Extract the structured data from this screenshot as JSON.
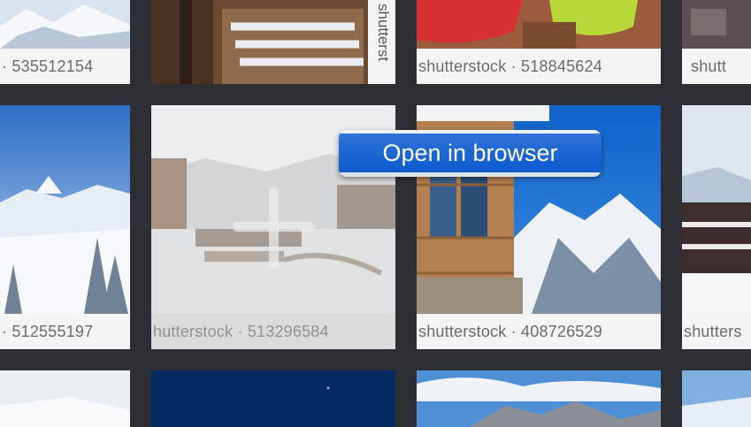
{
  "tiles": [
    {
      "caption": "· 535512154"
    },
    {
      "caption": "shutterst"
    },
    {
      "caption": "shutterstock · 518845624"
    },
    {
      "caption": "shutt"
    },
    {
      "caption": "· 512555197"
    },
    {
      "caption": "hutterstock · 513296584"
    },
    {
      "caption": "shutterstock · 408726529"
    },
    {
      "caption": "shutters"
    }
  ],
  "tooltip": {
    "label": "Open in browser"
  }
}
